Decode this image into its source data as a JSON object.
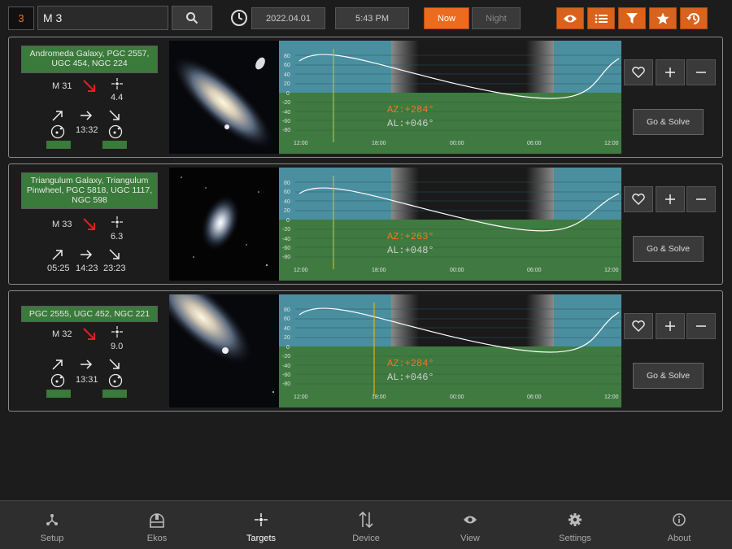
{
  "header": {
    "count": "3",
    "search_value": "M 3",
    "date": "2022.04.01",
    "time": "5:43 PM",
    "now_label": "Now",
    "night_label": "Night"
  },
  "targets": [
    {
      "names": "Andromeda Galaxy, PGC 2557, UGC 454, NGC 224",
      "id": "M 31",
      "magnitude": "4.4",
      "rise": "",
      "transit": "13:32",
      "set": "",
      "az": "AZ:+284°",
      "al": "AL:+046°",
      "go_solve": "Go & Solve"
    },
    {
      "names": "Triangulum Galaxy, Triangulum Pinwheel, PGC 5818, UGC 1117, NGC 598",
      "id": "M 33",
      "magnitude": "6.3",
      "rise": "05:25",
      "transit": "14:23",
      "set": "23:23",
      "az": "AZ:+263°",
      "al": "AL:+048°",
      "go_solve": "Go & Solve"
    },
    {
      "names": "PGC 2555, UGC 452, NGC 221",
      "id": "M 32",
      "magnitude": "9.0",
      "rise": "",
      "transit": "13:31",
      "set": "",
      "az": "AZ:+284°",
      "al": "AL:+046°",
      "go_solve": "Go & Solve"
    }
  ],
  "graph": {
    "y_ticks": [
      "80",
      "60",
      "40",
      "20",
      "0",
      "-20",
      "-40",
      "-60",
      "-80"
    ],
    "x_ticks": [
      "12:00",
      "18:00",
      "00:00",
      "06:00",
      "12:00"
    ]
  },
  "tabs": [
    {
      "label": "Setup",
      "icon": "setup-icon"
    },
    {
      "label": "Ekos",
      "icon": "ekos-icon"
    },
    {
      "label": "Targets",
      "icon": "targets-icon"
    },
    {
      "label": "Device",
      "icon": "device-icon"
    },
    {
      "label": "View",
      "icon": "view-icon"
    },
    {
      "label": "Settings",
      "icon": "settings-icon"
    },
    {
      "label": "About",
      "icon": "about-icon"
    }
  ],
  "colors": {
    "accent": "#ec6b1e",
    "green": "#3a7a3a",
    "sky": "#4a8fa0",
    "ground": "#3f7a40"
  }
}
